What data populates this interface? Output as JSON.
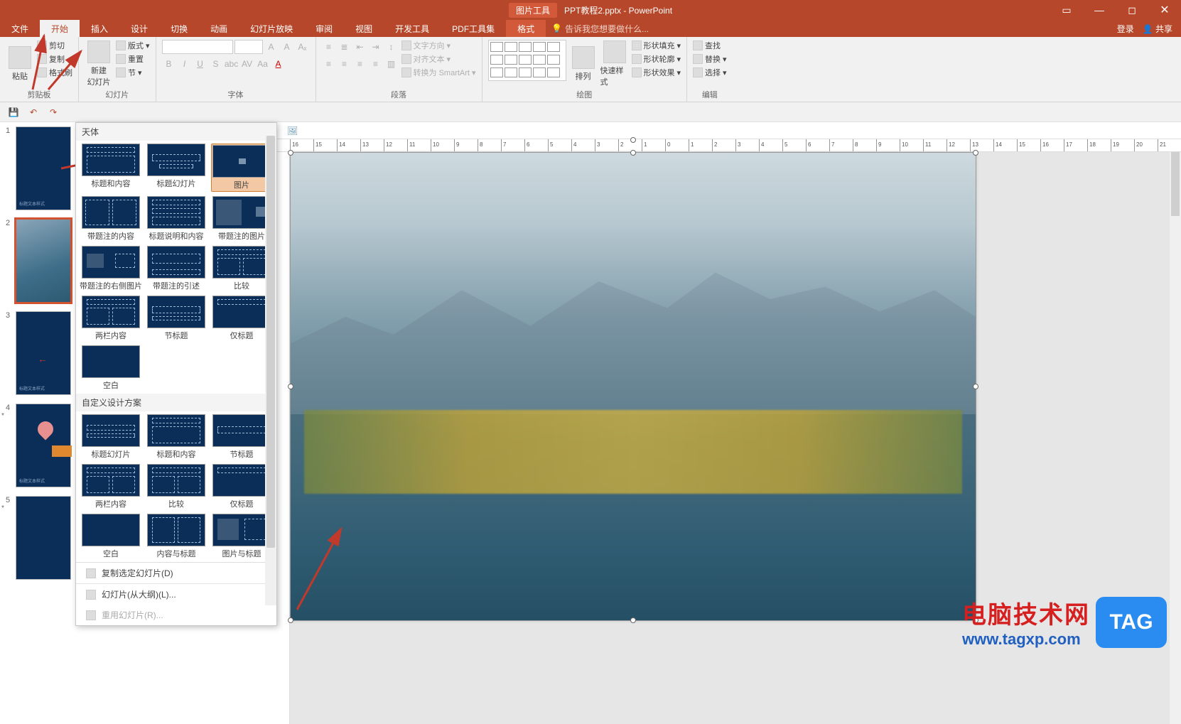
{
  "title_bar": {
    "picture_tools": "图片工具",
    "filename": "PPT教程2.pptx - PowerPoint"
  },
  "tabs": {
    "file": "文件",
    "home": "开始",
    "insert": "插入",
    "design": "设计",
    "transitions": "切换",
    "animations": "动画",
    "slideshow": "幻灯片放映",
    "review": "审阅",
    "view": "视图",
    "developer": "开发工具",
    "pdf": "PDF工具集",
    "format": "格式",
    "tellme_placeholder": "告诉我您想要做什么...",
    "login": "登录",
    "share": "共享"
  },
  "ribbon": {
    "clipboard": {
      "paste": "粘贴",
      "cut": "剪切",
      "copy": "复制",
      "format_painter": "格式刷",
      "group": "剪贴板"
    },
    "slides": {
      "new_slide": "新建\n幻灯片",
      "layout": "版式",
      "reset": "重置",
      "section": "节",
      "group": "幻灯片"
    },
    "font": {
      "group": "字体"
    },
    "paragraph": {
      "text_dir": "文字方向",
      "align": "对齐文本",
      "smartart": "转换为 SmartArt",
      "group": "段落"
    },
    "draw": {
      "arrange": "排列",
      "quick_style": "快速样式",
      "fill": "形状填充",
      "outline": "形状轮廓",
      "effects": "形状效果",
      "group": "绘图"
    },
    "editing": {
      "find": "查找",
      "replace": "替换",
      "select": "选择",
      "group": "编辑"
    }
  },
  "slides_panel": [
    {
      "num": "1"
    },
    {
      "num": "2"
    },
    {
      "num": "3"
    },
    {
      "num": "4"
    },
    {
      "num": "5"
    }
  ],
  "gallery": {
    "section1": "天体",
    "row1": [
      "标题和内容",
      "标题幻灯片",
      "图片"
    ],
    "row2": [
      "带题注的内容",
      "标题说明和内容",
      "带题注的图片"
    ],
    "row3": [
      "带题注的右侧图片",
      "带题注的引述",
      "比较"
    ],
    "row4": [
      "两栏内容",
      "节标题",
      "仅标题"
    ],
    "row5": [
      "空白"
    ],
    "section2": "自定义设计方案",
    "row6": [
      "标题幻灯片",
      "标题和内容",
      "节标题"
    ],
    "row7": [
      "两栏内容",
      "比较",
      "仅标题"
    ],
    "row8": [
      "空白",
      "内容与标题",
      "图片与标题"
    ],
    "footer": {
      "duplicate": "复制选定幻灯片(D)",
      "outline": "幻灯片(从大纲)(L)...",
      "reuse": "重用幻灯片(R)..."
    }
  },
  "ruler_ticks": [
    "16",
    "15",
    "14",
    "13",
    "12",
    "11",
    "10",
    "9",
    "8",
    "7",
    "6",
    "5",
    "4",
    "3",
    "2",
    "1",
    "0",
    "1",
    "2",
    "3",
    "4",
    "5",
    "6",
    "7",
    "8",
    "9",
    "10",
    "11",
    "12",
    "13",
    "14",
    "15",
    "16",
    "17",
    "18",
    "19",
    "20",
    "21"
  ],
  "watermark": {
    "cn": "电脑技术网",
    "url": "www.tagxp.com",
    "tag": "TAG"
  }
}
